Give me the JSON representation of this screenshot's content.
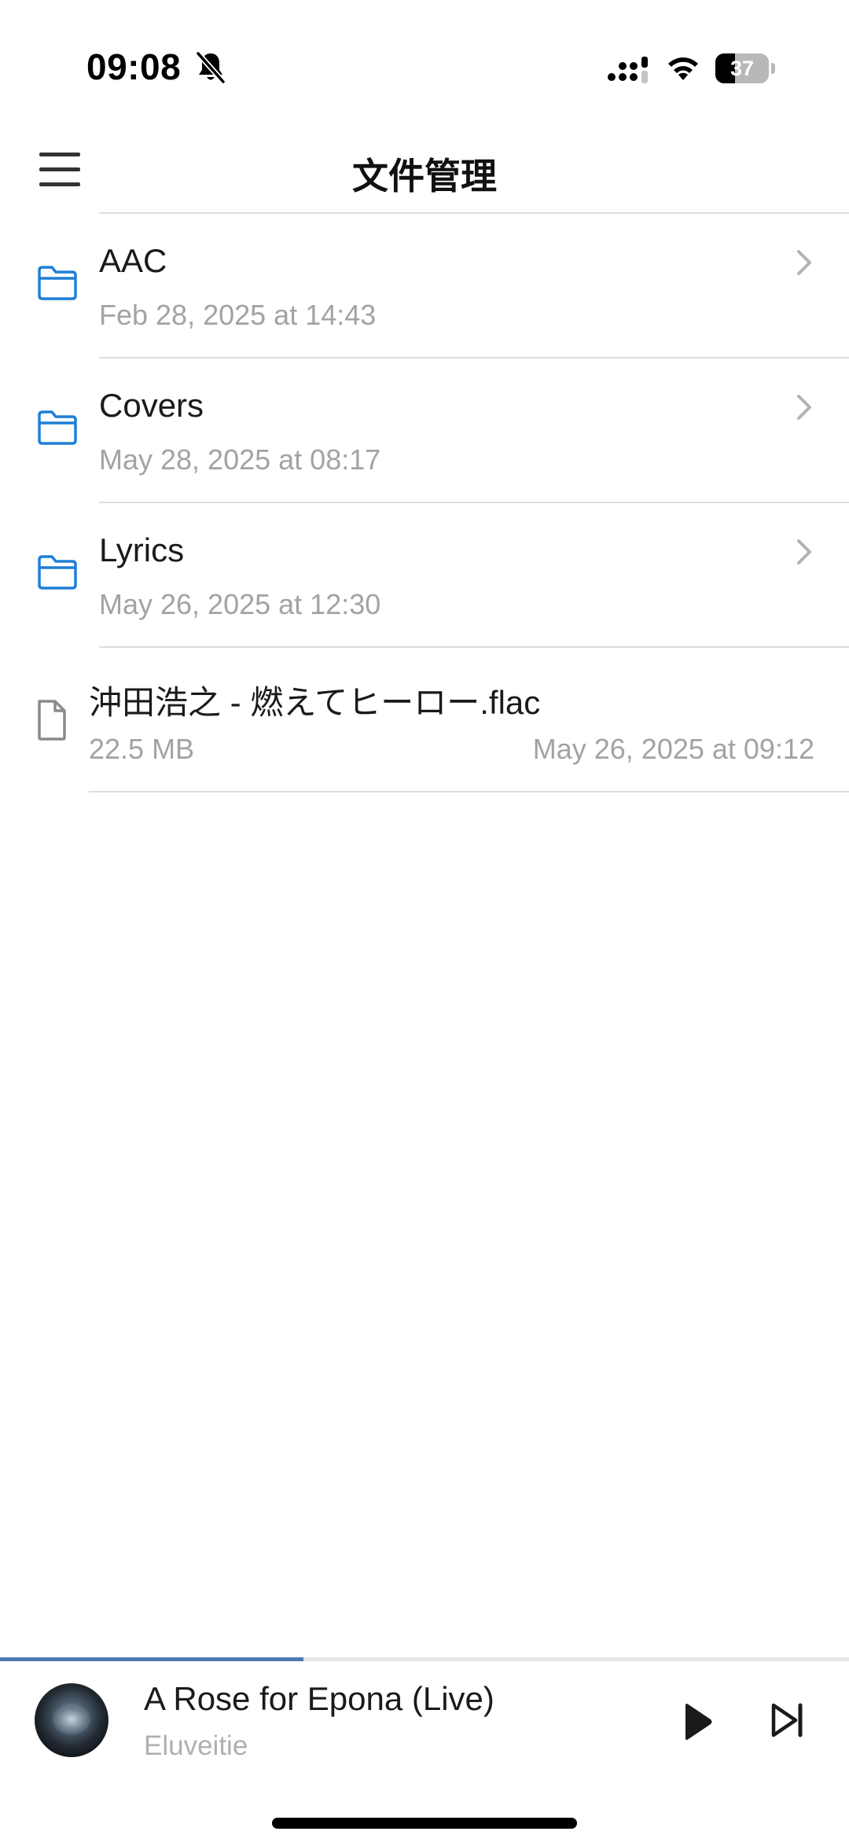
{
  "status_bar": {
    "time": "09:08",
    "battery": "37",
    "battery_level": 0.37,
    "icons": [
      "bell-slash-icon",
      "cellular-signal-icon",
      "wifi-icon",
      "battery-icon"
    ]
  },
  "nav": {
    "title": "文件管理",
    "menu_icon": "hamburger-menu-icon"
  },
  "files": [
    {
      "kind": "folder",
      "name": "AAC",
      "date": "Feb 28, 2025 at 14:43"
    },
    {
      "kind": "folder",
      "name": "Covers",
      "date": "May 28, 2025 at 08:17"
    },
    {
      "kind": "folder",
      "name": "Lyrics",
      "date": "May 26, 2025 at 12:30"
    },
    {
      "kind": "file",
      "name": "沖田浩之 - 燃えてヒーロー.flac",
      "size": "22.5 MB",
      "date": "May 26, 2025 at 09:12"
    }
  ],
  "player": {
    "title": "A Rose for Epona (Live)",
    "artist": "Eluveitie",
    "progress": 0.357,
    "controls": [
      "play-icon",
      "skip-next-icon"
    ]
  },
  "colors": {
    "accent": "#1e7fd6",
    "progress": "#4a7bb0",
    "secondary_text": "#a3a3a3",
    "divider": "#dddddd"
  }
}
